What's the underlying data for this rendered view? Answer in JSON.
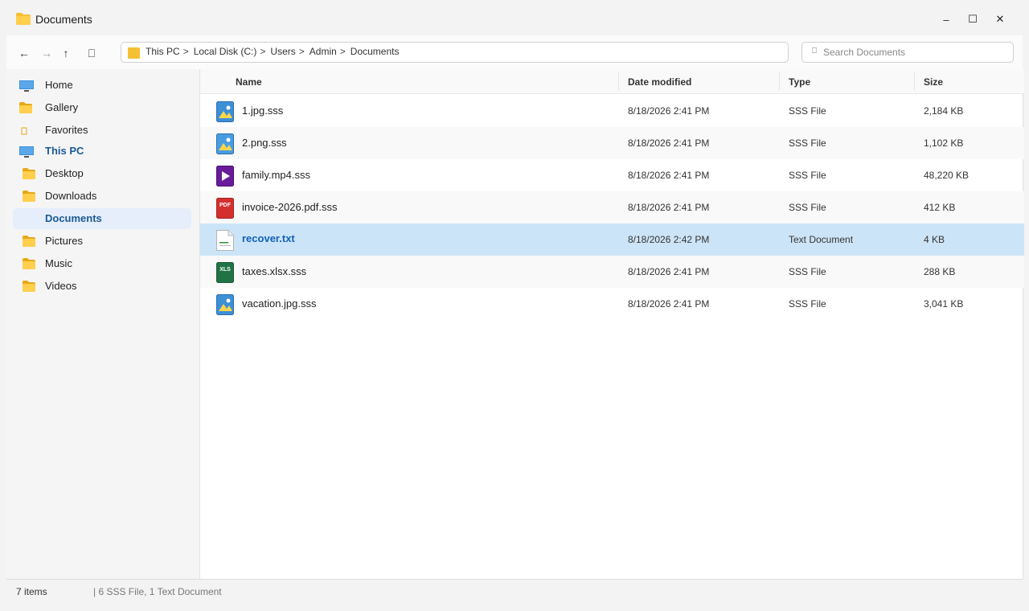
{
  "window": {
    "title": "Documents",
    "controls": {
      "minimize": "–",
      "maximize": "☐",
      "close": "✕"
    }
  },
  "toolbar": {
    "back": "←",
    "forward": "→",
    "up": "↑",
    "refresh": "⎕",
    "breadcrumbs": [
      "This PC",
      "Local Disk (C:)",
      "Users",
      "Admin",
      "Documents"
    ],
    "separator": ">",
    "search_placeholder": "Search Documents"
  },
  "sidebar": {
    "items": [
      {
        "label": "Home",
        "icon": "monitor-icon"
      },
      {
        "label": "Gallery",
        "icon": "folder-icon"
      },
      {
        "label": "Favorites",
        "icon": "star-icon"
      },
      {
        "label": "This PC",
        "icon": "monitor-icon"
      },
      {
        "label": "Desktop",
        "icon": "folder-icon"
      },
      {
        "label": "Downloads",
        "icon": "folder-icon"
      },
      {
        "label": "Documents",
        "icon": "folder-icon",
        "selected": true
      },
      {
        "label": "Pictures",
        "icon": "folder-icon"
      },
      {
        "label": "Music",
        "icon": "folder-icon"
      },
      {
        "label": "Videos",
        "icon": "folder-icon"
      }
    ]
  },
  "columns": {
    "name": "Name",
    "date": "Date modified",
    "type": "Type",
    "size": "Size"
  },
  "files": [
    {
      "name": "1.jpg.sss",
      "date": "8/18/2026 2:41 PM",
      "type": "SSS File",
      "size": "2,184 KB",
      "icon": "image-icon"
    },
    {
      "name": "2.png.sss",
      "date": "8/18/2026 2:41 PM",
      "type": "SSS File",
      "size": "1,102 KB",
      "icon": "image-icon"
    },
    {
      "name": "family.mp4.sss",
      "date": "8/18/2026 2:41 PM",
      "type": "SSS File",
      "size": "48,220 KB",
      "icon": "video-icon"
    },
    {
      "name": "invoice-2026.pdf.sss",
      "date": "8/18/2026 2:41 PM",
      "type": "SSS File",
      "size": "412 KB",
      "icon": "pdf-icon",
      "badge": "PDF"
    },
    {
      "name": "recover.txt",
      "date": "8/18/2026 2:42 PM",
      "type": "Text Document",
      "size": "4 KB",
      "icon": "text-file-icon",
      "selected": true
    },
    {
      "name": "taxes.xlsx.sss",
      "date": "8/18/2026 2:41 PM",
      "type": "SSS File",
      "size": "288 KB",
      "icon": "spreadsheet-icon",
      "badge": "XLS"
    },
    {
      "name": "vacation.jpg.sss",
      "date": "8/18/2026 2:41 PM",
      "type": "SSS File",
      "size": "3,041 KB",
      "icon": "image-icon"
    }
  ],
  "status": {
    "count": "7 items",
    "detail": "|  6 SSS File, 1 Text Document"
  },
  "colors": {
    "folder": "#f5c033",
    "selection": "#cce4f7",
    "link_blue": "#1160b8",
    "pdf_red": "#d32f2f",
    "xls_green": "#217346",
    "video_purple": "#6a1b9a",
    "image_blue": "#3d8fd6"
  }
}
